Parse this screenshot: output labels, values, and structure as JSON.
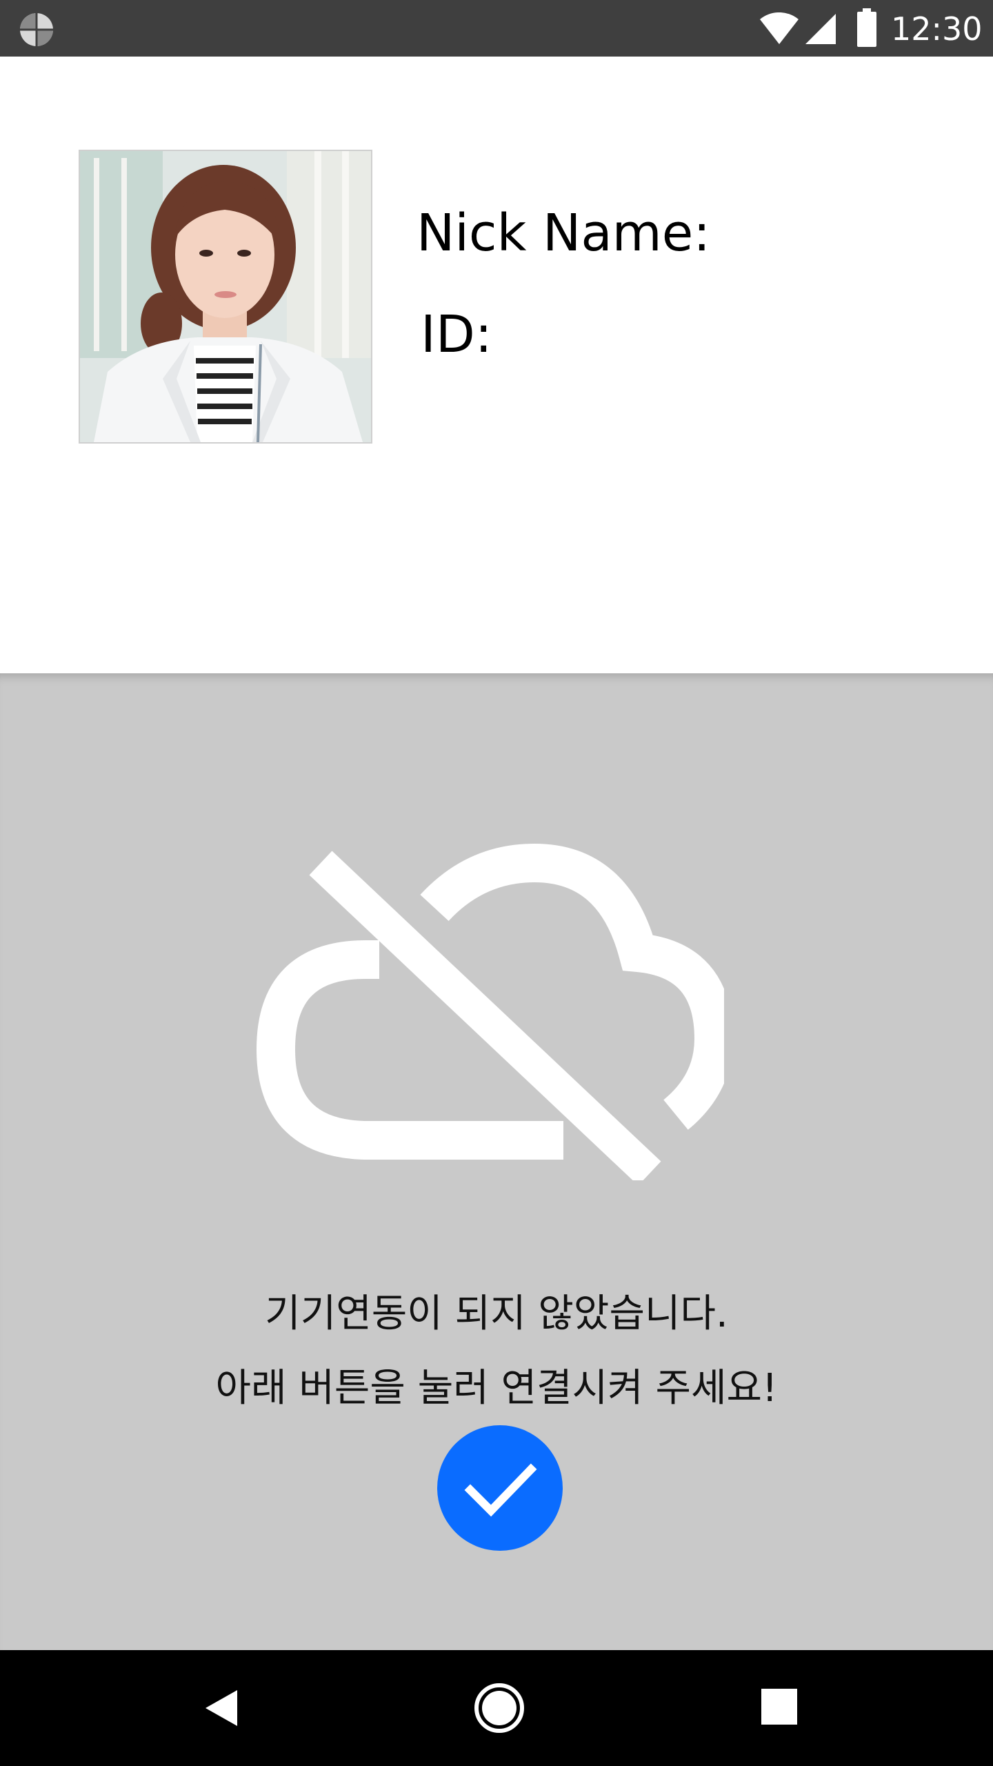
{
  "status_bar": {
    "time": "12:30",
    "app_icon": "app-pie-icon",
    "wifi_icon": "wifi-icon",
    "signal_icon": "cell-signal-icon",
    "battery_icon": "battery-icon"
  },
  "profile": {
    "avatar": "profile-photo",
    "nick_name_label": "Nick Name:",
    "id_label": "ID:"
  },
  "status_panel": {
    "icon": "cloud-off-icon",
    "message_line1": "기기연동이 되지 않았습니다.",
    "message_line2": "아래 버튼을 눌러 연결시켜 주세요!",
    "confirm_icon": "check-icon",
    "button_color": "#0a6cff",
    "background_color": "#c9c9c9"
  },
  "nav_bar": {
    "back_icon": "back-icon",
    "home_icon": "home-icon",
    "recents_icon": "recents-icon"
  }
}
